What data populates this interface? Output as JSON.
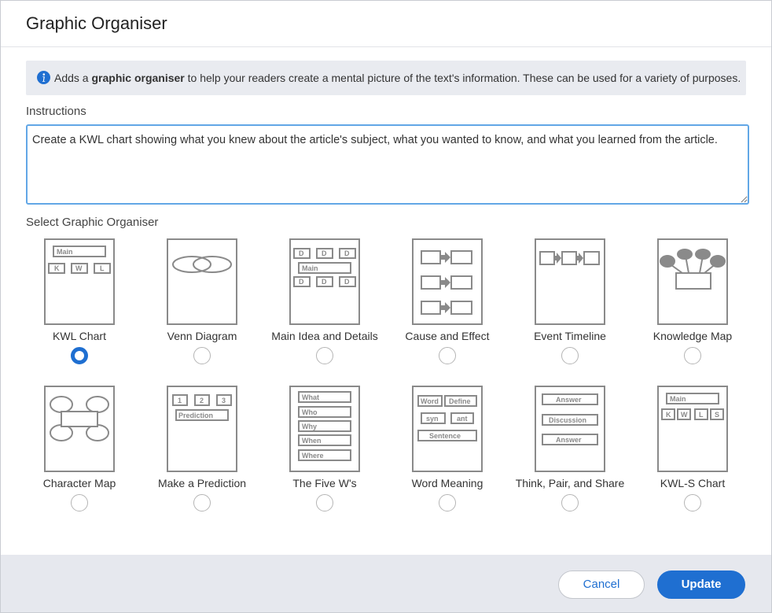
{
  "dialog": {
    "title": "Graphic Organiser"
  },
  "info": {
    "prefix": "Adds a ",
    "bold": "graphic organiser",
    "suffix": " to help your readers create a mental picture of the text's information. These can be used for a variety of purposes."
  },
  "instructions": {
    "label": "Instructions",
    "value": "Create a KWL chart showing what you knew about the article's subject, what you wanted to know, and what you learned from the article."
  },
  "select": {
    "label": "Select Graphic Organiser",
    "selected": "KWL Chart"
  },
  "organisers": [
    {
      "label": "KWL Chart",
      "thumb": {
        "main": "Main",
        "k": "K",
        "w": "W",
        "l": "L"
      }
    },
    {
      "label": "Venn Diagram",
      "thumb": {}
    },
    {
      "label": "Main Idea and Details",
      "thumb": {
        "main": "Main",
        "d": "D"
      }
    },
    {
      "label": "Cause and Effect",
      "thumb": {}
    },
    {
      "label": "Event Timeline",
      "thumb": {}
    },
    {
      "label": "Knowledge Map",
      "thumb": {}
    },
    {
      "label": "Character Map",
      "thumb": {}
    },
    {
      "label": "Make a Prediction",
      "thumb": {
        "n1": "1",
        "n2": "2",
        "n3": "3",
        "prediction": "Prediction"
      }
    },
    {
      "label": "The Five W's",
      "thumb": {
        "what": "What",
        "who": "Who",
        "why": "Why",
        "when": "When",
        "where": "Where"
      }
    },
    {
      "label": "Word Meaning",
      "thumb": {
        "word": "Word",
        "define": "Define",
        "syn": "syn",
        "ant": "ant",
        "sentence": "Sentence"
      }
    },
    {
      "label": "Think, Pair, and Share",
      "thumb": {
        "answer": "Answer",
        "discussion": "Discussion"
      }
    },
    {
      "label": "KWL-S Chart",
      "thumb": {
        "main": "Main",
        "k": "K",
        "w": "W",
        "l": "L",
        "s": "S"
      }
    }
  ],
  "footer": {
    "cancel_label": "Cancel",
    "update_label": "Update"
  },
  "colors": {
    "accent": "#1f6fd1",
    "focus_border": "#62a7e6",
    "footer_bg": "#e6e8ee",
    "info_bg": "#e9ebf0"
  }
}
